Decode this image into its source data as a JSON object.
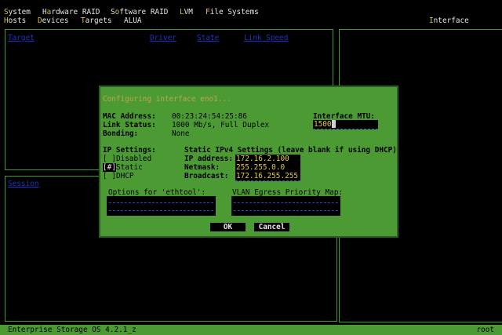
{
  "menu": {
    "row1": [
      {
        "hk": "S",
        "rest": "ystem"
      },
      {
        "hk": "",
        "pre": "H",
        "mid": "a",
        "rest": "rdware RAID"
      },
      {
        "hk": "",
        "pre": "S",
        "mid": "o",
        "rest": "ftware RAID"
      },
      {
        "hk": "L",
        "rest": "VM"
      },
      {
        "hk": "F",
        "rest": "ile Systems"
      }
    ],
    "row2": [
      {
        "hk": "H",
        "rest": "osts"
      },
      {
        "hk": "D",
        "rest": "evices"
      },
      {
        "hk": "T",
        "rest": "argets"
      },
      {
        "hk": "",
        "rest": "ALUA"
      }
    ],
    "interface_hk": "I",
    "interface_rest": "nterface"
  },
  "targets_panel": {
    "headers": {
      "target": "Target",
      "driver": "Driver",
      "state": "State",
      "link_speed": "Link Speed"
    }
  },
  "session_panel": {
    "header": "Session"
  },
  "dialog": {
    "title": "Configuring interface eno1...",
    "mac_label": "MAC Address:",
    "mac_value": "00:23:24:54:25:86",
    "link_label": "Link Status:",
    "link_value": "1000 Mb/s, Full Duplex",
    "bonding_label": "Bonding:",
    "bonding_value": "None",
    "mtu_label": "Interface MTU:",
    "mtu_value": "1500",
    "ip_settings_label": "IP Settings:",
    "ip_options": [
      {
        "box": "[ ]",
        "label": "Disabled",
        "selected": false
      },
      {
        "box": "[#]",
        "label": "Static",
        "selected": true
      },
      {
        "box": "[ ]",
        "label": "DHCP",
        "selected": false
      }
    ],
    "static_title": "Static IPv4 Settings (leave blank if using DHCP)",
    "ip_label": "IP address:",
    "ip_value": "172.16.2.100",
    "netmask_label": "Netmask:",
    "netmask_value": "255.255.0.0",
    "broadcast_label": "Broadcast:",
    "broadcast_value": "172.16.255.255",
    "ethtool_label": "Options for 'ethtool':",
    "vlan_label": "VLAN Egress Priority Map:",
    "ok_label": "OK",
    "cancel_label": "Cancel"
  },
  "status": {
    "left": "Enterprise Storage OS 4.2.1_z",
    "right": "root"
  }
}
